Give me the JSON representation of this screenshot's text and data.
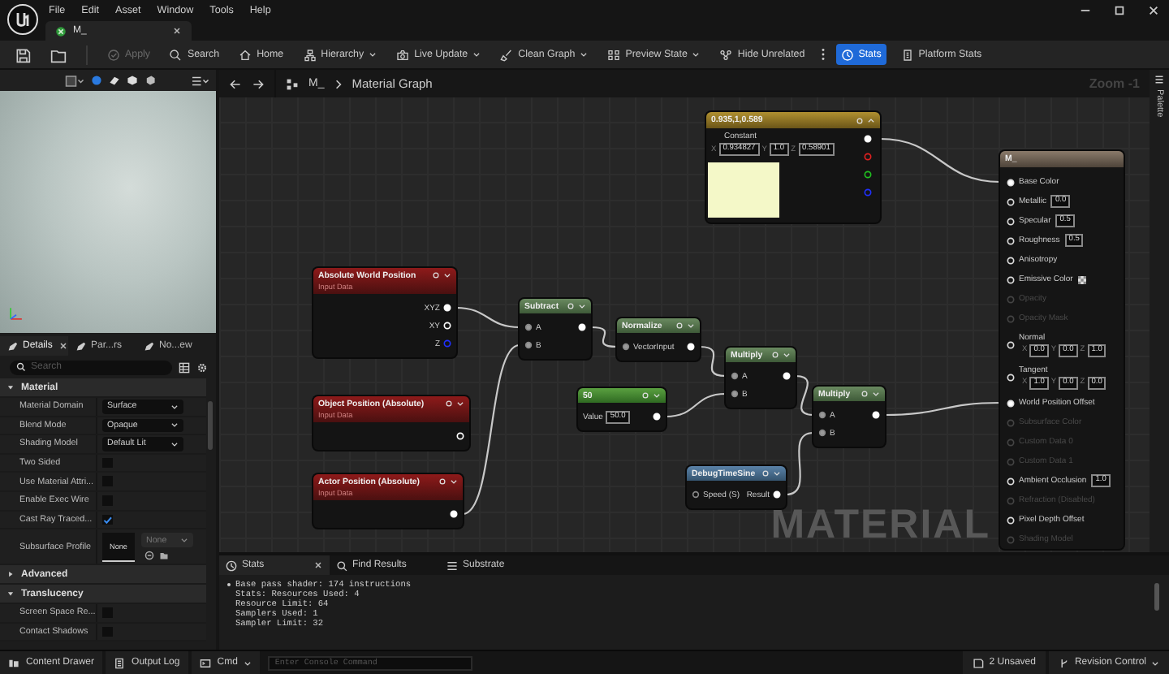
{
  "menu": [
    "File",
    "Edit",
    "Asset",
    "Window",
    "Tools",
    "Help"
  ],
  "document_tab": {
    "label": "M_"
  },
  "toolbar": [
    {
      "label": "Apply",
      "dropdown": false,
      "disabled": true,
      "on": false
    },
    {
      "label": "Search",
      "dropdown": false,
      "disabled": false,
      "on": false
    },
    {
      "label": "Home",
      "dropdown": false,
      "disabled": false,
      "on": false
    },
    {
      "label": "Hierarchy",
      "dropdown": true,
      "disabled": false,
      "on": false
    },
    {
      "label": "Live Update",
      "dropdown": true,
      "disabled": false,
      "on": false
    },
    {
      "label": "Clean Graph",
      "dropdown": true,
      "disabled": false,
      "on": false
    },
    {
      "label": "Preview State",
      "dropdown": true,
      "disabled": false,
      "on": false
    },
    {
      "label": "Hide Unrelated",
      "dropdown": false,
      "disabled": false,
      "on": false
    },
    {
      "label": "Stats",
      "dropdown": false,
      "disabled": false,
      "on": true
    },
    {
      "label": "Platform Stats",
      "dropdown": false,
      "disabled": false,
      "on": false
    }
  ],
  "details": {
    "tabs": [
      {
        "label": "Details",
        "selected": true
      },
      {
        "label": "Par...rs",
        "selected": false
      },
      {
        "label": "No...ew",
        "selected": false
      }
    ],
    "search": {
      "placeholder": "Search"
    },
    "sections": [
      {
        "title": "Material",
        "expanded": true,
        "rows": [
          {
            "kind": "dropdown",
            "label": "Material Domain",
            "value": "Surface"
          },
          {
            "kind": "dropdown",
            "label": "Blend Mode",
            "value": "Opaque"
          },
          {
            "kind": "dropdown",
            "label": "Shading Model",
            "value": "Default Lit"
          },
          {
            "kind": "checkbox",
            "label": "Two Sided",
            "checked": false
          },
          {
            "kind": "checkbox",
            "label": "Use Material Attri...",
            "checked": false
          },
          {
            "kind": "checkbox",
            "label": "Enable Exec Wire",
            "checked": false
          },
          {
            "kind": "checkbox",
            "label": "Cast Ray Traced...",
            "checked": true
          },
          {
            "kind": "asset",
            "label": "Subsurface Profile",
            "thumbnail": "None",
            "value": "None"
          }
        ]
      },
      {
        "title": "Advanced",
        "expanded": false
      },
      {
        "title": "Translucency",
        "expanded": true,
        "rows": [
          {
            "kind": "checkbox",
            "label": "Screen Space Re...",
            "checked": false
          },
          {
            "kind": "checkbox",
            "label": "Contact Shadows",
            "checked": false
          }
        ]
      }
    ]
  },
  "graph": {
    "breadcrumb": [
      "M_",
      "Material Graph"
    ],
    "zoom": "Zoom -1",
    "palette": "Palette",
    "label": "MATERIAL",
    "nodes": [
      {
        "kind": "vector",
        "title": "0.935,1,0.589",
        "label": "Constant",
        "fields": [
          {
            "axis": "X",
            "value": "0.934827"
          },
          {
            "axis": "Y",
            "value": "1.0"
          },
          {
            "axis": "Z",
            "value": "0.58901"
          }
        ],
        "color": "#f4f8c8",
        "outputs": [
          {
            "connected": true,
            "color": "#ffffff"
          },
          {
            "connected": false,
            "color": "#e02020"
          },
          {
            "connected": false,
            "color": "#20c020"
          },
          {
            "connected": false,
            "color": "#2030ff"
          }
        ]
      },
      {
        "kind": "result",
        "title": "M_",
        "inputs": [
          {
            "kind": "plain",
            "label": "Base Color",
            "connected": true,
            "disabled": false
          },
          {
            "kind": "scalar",
            "label": "Metallic",
            "value": "0.0",
            "connected": false,
            "disabled": false
          },
          {
            "kind": "scalar",
            "label": "Specular",
            "value": "0.5",
            "connected": false,
            "disabled": false
          },
          {
            "kind": "scalar",
            "label": "Roughness",
            "value": "0.5",
            "connected": false,
            "disabled": false
          },
          {
            "kind": "plain",
            "label": "Anisotropy",
            "connected": false,
            "disabled": false
          },
          {
            "kind": "color",
            "label": "Emissive Color",
            "connected": false,
            "disabled": false
          },
          {
            "kind": "plain",
            "label": "Opacity",
            "connected": false,
            "disabled": true
          },
          {
            "kind": "plain",
            "label": "Opacity Mask",
            "connected": false,
            "disabled": true
          },
          {
            "kind": "vector",
            "label": "Normal",
            "fields": [
              {
                "axis": "X",
                "value": "0.0"
              },
              {
                "axis": "Y",
                "value": "0.0"
              },
              {
                "axis": "Z",
                "value": "1.0"
              }
            ],
            "connected": false,
            "disabled": false
          },
          {
            "kind": "vector",
            "label": "Tangent",
            "fields": [
              {
                "axis": "X",
                "value": "1.0"
              },
              {
                "axis": "Y",
                "value": "0.0"
              },
              {
                "axis": "Z",
                "value": "0.0"
              }
            ],
            "connected": false,
            "disabled": false
          },
          {
            "kind": "plain",
            "label": "World Position Offset",
            "connected": true,
            "disabled": false
          },
          {
            "kind": "plain",
            "label": "Subsurface Color",
            "connected": false,
            "disabled": true
          },
          {
            "kind": "plain",
            "label": "Custom Data 0",
            "connected": false,
            "disabled": true
          },
          {
            "kind": "plain",
            "label": "Custom Data 1",
            "connected": false,
            "disabled": true
          },
          {
            "kind": "scalar",
            "label": "Ambient Occlusion",
            "value": "1.0",
            "connected": false,
            "disabled": false
          },
          {
            "kind": "plain",
            "label": "Refraction (Disabled)",
            "connected": false,
            "disabled": true
          },
          {
            "kind": "plain",
            "label": "Pixel Depth Offset",
            "connected": false,
            "disabled": false
          },
          {
            "kind": "plain",
            "label": "Shading Model",
            "connected": false,
            "disabled": true
          }
        ]
      },
      {
        "kind": "input",
        "title": "Absolute World Position",
        "subtitle": "Input Data",
        "outputs": [
          {
            "label": "XYZ",
            "connected": true,
            "color": "#ffffff"
          },
          {
            "label": "XY",
            "connected": false,
            "color": "#ffffff"
          },
          {
            "label": "Z",
            "connected": false,
            "color": "#2030ff"
          }
        ]
      },
      {
        "kind": "input",
        "title": "Object Position (Absolute)",
        "subtitle": "Input Data",
        "outputs": [
          {
            "connected": false
          }
        ]
      },
      {
        "kind": "input",
        "title": "Actor Position (Absolute)",
        "subtitle": "Input Data",
        "outputs": [
          {
            "connected": true
          }
        ]
      },
      {
        "kind": "math",
        "title": "Subtract",
        "inputs": [
          {
            "label": "A",
            "connected": true
          },
          {
            "label": "B",
            "connected": true
          }
        ],
        "outputs": [
          {
            "connected": true
          }
        ]
      },
      {
        "kind": "math",
        "title": "Normalize",
        "inputs": [
          {
            "label": "VectorInput",
            "connected": true
          }
        ],
        "outputs": [
          {
            "connected": true
          }
        ]
      },
      {
        "kind": "math",
        "title": "Multiply",
        "inputs": [
          {
            "label": "A",
            "connected": true
          },
          {
            "label": "B",
            "connected": true
          }
        ],
        "outputs": [
          {
            "connected": true
          }
        ]
      },
      {
        "kind": "constant",
        "title": "50",
        "fields": [
          {
            "label": "Value",
            "value": "50.0"
          }
        ],
        "outputs": [
          {
            "connected": true
          }
        ]
      },
      {
        "kind": "math",
        "title": "Multiply",
        "inputs": [
          {
            "label": "A",
            "connected": true
          },
          {
            "label": "B",
            "connected": true
          }
        ],
        "outputs": [
          {
            "connected": true
          }
        ]
      },
      {
        "kind": "function",
        "title": "DebugTimeSine",
        "inputs": [
          {
            "label": "Speed (S)",
            "connected": false
          }
        ],
        "outputs": [
          {
            "label": "Result",
            "connected": true
          }
        ]
      }
    ]
  },
  "stats_panel": {
    "tabs": [
      {
        "label": "Stats",
        "selected": true
      },
      {
        "label": "Find Results",
        "selected": false
      },
      {
        "label": "Substrate",
        "selected": false
      }
    ],
    "lines": [
      "Base pass shader: 174 instructions",
      "Stats: Resources Used: 4",
      "Resource Limit: 64",
      "Samplers Used: 1",
      "Sampler Limit: 32"
    ]
  },
  "status_bar": {
    "content_drawer": "Content Drawer",
    "output_log": "Output Log",
    "cmd": "Cmd",
    "console": {
      "placeholder": "Enter Console Command"
    },
    "unsaved": "2 Unsaved",
    "revision_control": "Revision Control"
  }
}
